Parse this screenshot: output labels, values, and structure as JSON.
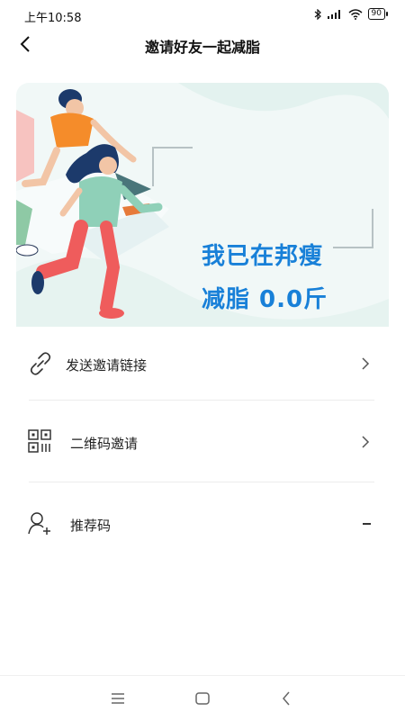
{
  "status": {
    "time": "上午10:58",
    "battery": "90"
  },
  "header": {
    "title": "邀请好友一起减脂"
  },
  "banner": {
    "line1": "我已在邦瘦",
    "line2": "减脂  0.0斤"
  },
  "menu": {
    "items": [
      {
        "label": "发送邀请链接",
        "icon": "link-icon"
      },
      {
        "label": "二维码邀请",
        "icon": "qr-code-icon"
      },
      {
        "label": "推荐码",
        "icon": "add-user-icon",
        "value": "–"
      }
    ]
  },
  "colors": {
    "accent": "#1880d8",
    "banner_bg": "#f1f8f7"
  }
}
